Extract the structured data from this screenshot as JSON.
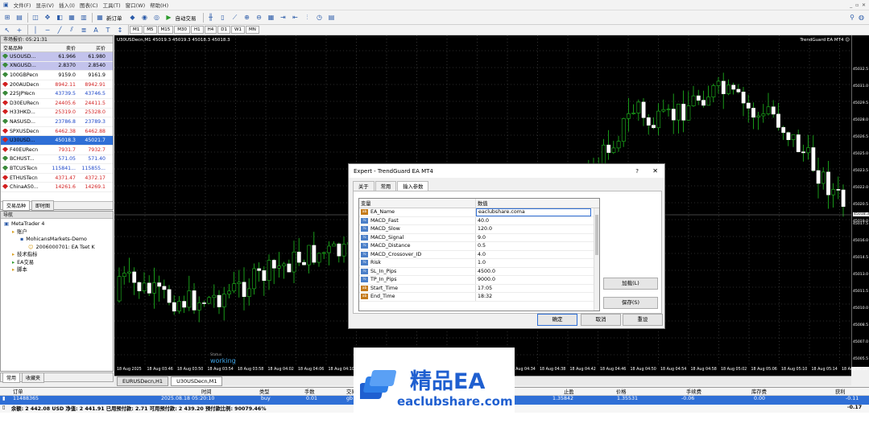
{
  "menu": {
    "items": [
      "文件(F)",
      "显示(V)",
      "插入(I)",
      "图表(C)",
      "工具(T)",
      "窗口(W)",
      "帮助(H)"
    ]
  },
  "toolbar": {
    "new_order": "新订单",
    "auto_trading": "自动交易",
    "timeframes": [
      "M1",
      "M5",
      "M15",
      "M30",
      "H1",
      "H4",
      "D1",
      "W1",
      "MN"
    ]
  },
  "market_watch": {
    "title": "市场报价: 05:21:31",
    "col_symbol": "交易品种",
    "col_bid": "卖价",
    "col_ask": "买价",
    "rows": [
      {
        "symbol": "USOUSD...",
        "bid": "61.966",
        "ask": "61.980",
        "hl": "#c3c3ec",
        "color": "#000",
        "dot": "#3a8a3a"
      },
      {
        "symbol": "XNGUSD...",
        "bid": "2.8370",
        "ask": "2.8540",
        "hl": "#c3c3ec",
        "color": "#000",
        "dot": "#3a8a3a"
      },
      {
        "symbol": "100GBPecn",
        "bid": "9159.0",
        "ask": "9161.9",
        "hl": "",
        "color": "#000",
        "dot": "#3a8a3a"
      },
      {
        "symbol": "200AUDecn",
        "bid": "8942.11",
        "ask": "8942.91",
        "hl": "",
        "color": "#d21f1f",
        "dot": "#d21f1f"
      },
      {
        "symbol": "225JPYecn",
        "bid": "43739.5",
        "ask": "43746.5",
        "hl": "",
        "color": "#1a44c8",
        "dot": "#3a8a3a"
      },
      {
        "symbol": "D30EURecn",
        "bid": "24405.6",
        "ask": "24411.5",
        "hl": "",
        "color": "#d21f1f",
        "dot": "#d21f1f"
      },
      {
        "symbol": "H33HKD...",
        "bid": "25319.0",
        "ask": "25328.0",
        "hl": "",
        "color": "#d21f1f",
        "dot": "#d21f1f"
      },
      {
        "symbol": "NASUSD...",
        "bid": "23786.8",
        "ask": "23789.3",
        "hl": "",
        "color": "#1a44c8",
        "dot": "#3a8a3a"
      },
      {
        "symbol": "SPXUSDecn",
        "bid": "6462.38",
        "ask": "6462.88",
        "hl": "",
        "color": "#d21f1f",
        "dot": "#d21f1f"
      },
      {
        "symbol": "U30USD...",
        "bid": "45018.3",
        "ask": "45021.7",
        "hl": "#2f6fd6",
        "color": "#fff",
        "dot": "#d21f1f"
      },
      {
        "symbol": "F40EURecn",
        "bid": "7931.7",
        "ask": "7932.7",
        "hl": "",
        "color": "#d21f1f",
        "dot": "#d21f1f"
      },
      {
        "symbol": "BCHUST...",
        "bid": "571.05",
        "ask": "571.40",
        "hl": "",
        "color": "#1a44c8",
        "dot": "#3a8a3a"
      },
      {
        "symbol": "BTCUSTecn",
        "bid": "115841...",
        "ask": "115855...",
        "hl": "",
        "color": "#1a44c8",
        "dot": "#3a8a3a"
      },
      {
        "symbol": "ETHUSTecn",
        "bid": "4371.47",
        "ask": "4372.17",
        "hl": "",
        "color": "#d21f1f",
        "dot": "#d21f1f"
      },
      {
        "symbol": "ChinaA50...",
        "bid": "14261.6",
        "ask": "14269.1",
        "hl": "",
        "color": "#d21f1f",
        "dot": "#d21f1f"
      }
    ],
    "tabs": [
      "交易品种",
      "即时图"
    ]
  },
  "navigator": {
    "title": "导航",
    "items": [
      {
        "label": "MetaTrader 4",
        "indent": 0
      },
      {
        "label": "账户",
        "indent": 1
      },
      {
        "label": "MohicansMarkets-Demo",
        "indent": 2
      },
      {
        "label": "2006000701: EA  Tset  K",
        "indent": 3
      },
      {
        "label": "技术指标",
        "indent": 1
      },
      {
        "label": "EA交易",
        "indent": 1
      },
      {
        "label": "脚本",
        "indent": 1
      }
    ],
    "tabs": [
      "常用",
      "收藏夹"
    ]
  },
  "chart": {
    "header": "U30USDecn,M1  45019.3 45019.3 45018.3 45018.3",
    "ea_label": "TrendGuard EA MT4 ☺",
    "status_small": "Status",
    "status": "working",
    "price_ticks": [
      "45032.5",
      "45031.0",
      "45029.5",
      "45028.0",
      "45026.5",
      "45025.0",
      "45023.5",
      "45022.0",
      "45020.5",
      "45019.0",
      "45018.3",
      "45017.5",
      "45016.0",
      "45014.5",
      "45013.0",
      "45011.5",
      "45010.0",
      "45008.5",
      "45007.0",
      "45005.5"
    ],
    "time_ticks": [
      "18 Aug 2025",
      "18 Aug 03:46",
      "18 Aug 03:50",
      "18 Aug 03:54",
      "18 Aug 03:58",
      "18 Aug 04:02",
      "18 Aug 04:06",
      "18 Aug 04:10",
      "18 Aug 04:14",
      "18 Aug 04:18",
      "18 Aug 04:22",
      "18 Aug 04:26",
      "18 Aug 04:30",
      "18 Aug 04:34",
      "18 Aug 04:38",
      "18 Aug 04:42",
      "18 Aug 04:46",
      "18 Aug 04:50",
      "18 Aug 04:54",
      "18 Aug 04:58",
      "18 Aug 05:02",
      "18 Aug 05:06",
      "18 Aug 05:10",
      "18 Aug 05:14",
      "18 Aug 05:18"
    ],
    "current_price": "45018.3",
    "tabs": [
      "EURUSDecn,H1",
      "U30USDecn,M1"
    ]
  },
  "dialog": {
    "title": "Expert - TrendGuard EA MT4",
    "help": "?",
    "tabs": [
      "关于",
      "常用",
      "输入参数"
    ],
    "col_var": "变量",
    "col_val": "数值",
    "params": [
      {
        "name": "EA_Name",
        "value": "eaclubshare.coma",
        "type": "ab"
      },
      {
        "name": "MACD_Fast",
        "value": "40.0",
        "type": "num"
      },
      {
        "name": "MACD_Slow",
        "value": "120.0",
        "type": "num"
      },
      {
        "name": "MACD_Signal",
        "value": "9.0",
        "type": "num"
      },
      {
        "name": "MACD_Distance",
        "value": "0.5",
        "type": "num"
      },
      {
        "name": "MACD_Crossover_ID",
        "value": "4.0",
        "type": "num"
      },
      {
        "name": "Risk",
        "value": "1.0",
        "type": "num"
      },
      {
        "name": "SL_In_Pips",
        "value": "4500.0",
        "type": "num"
      },
      {
        "name": "TP_In_Pips",
        "value": "9000.0",
        "type": "num"
      },
      {
        "name": "Start_Time",
        "value": "17:05",
        "type": "ab"
      },
      {
        "name": "End_Time",
        "value": "18:32",
        "type": "ab"
      }
    ],
    "load": "加载(L)",
    "save": "保存(S)",
    "ok": "确定",
    "cancel": "取消",
    "reset": "重设"
  },
  "watermark": {
    "title": "精品EA",
    "site": "eaclubshare.com"
  },
  "terminal": {
    "headers": {
      "order": "订单",
      "time": "时间",
      "type": "类型",
      "lots": "手数",
      "symbol": "交易品种",
      "tp": "止盈",
      "price": "价格",
      "commission": "手续费",
      "swap": "库存费",
      "profit": "获利"
    },
    "row": {
      "order": "11488365",
      "time": "2025.08.18 05:20:10",
      "type": "buy",
      "lots": "0.01",
      "symbol": "gb",
      "tp": "1.35842",
      "price": "1.35531",
      "commission": "-0.06",
      "swap": "0.00",
      "profit": "-0.11"
    },
    "summary": "余额: 2 442.08 USD  净值: 2 441.91  已用预付款: 2.71  可用预付款: 2 439.20  预付款比例: 90079.46%",
    "summary_profit": "-0.17"
  }
}
